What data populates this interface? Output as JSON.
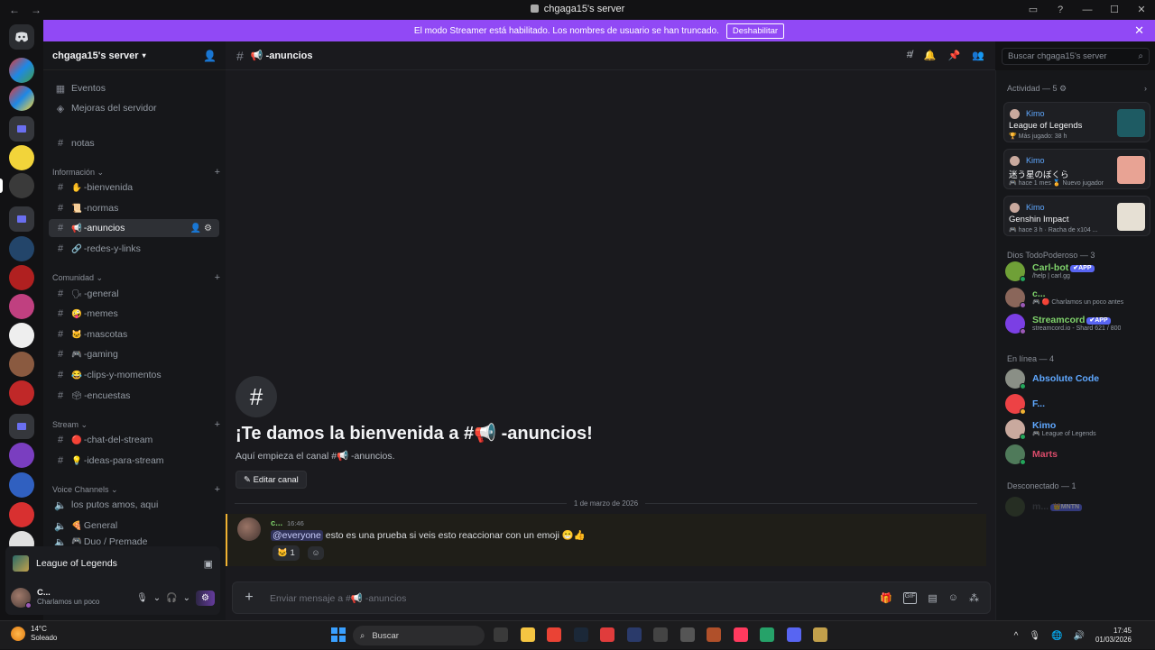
{
  "window": {
    "title": "chgaga15's server",
    "back": "←",
    "forward": "→",
    "controls": [
      "▭",
      "?",
      "—",
      "☐",
      "✕"
    ]
  },
  "banner": {
    "text": "El modo Streamer está habilitado. Los nombres de usuario se han truncado.",
    "button": "Deshabilitar",
    "close": "✕"
  },
  "server": {
    "name": "chgaga15's server",
    "caret": "▾",
    "invite_icon": "👤"
  },
  "sidebar": {
    "top_items": [
      {
        "icon": "▦",
        "label": "Eventos"
      },
      {
        "icon": "◈",
        "label": "Mejoras del servidor"
      }
    ],
    "standalone": {
      "label": "notas"
    },
    "categories": [
      {
        "name": "Información ⌄",
        "channels": [
          {
            "emoji": "✋",
            "label": "-bienvenida"
          },
          {
            "emoji": "📜",
            "label": "-normas"
          },
          {
            "emoji": "📢",
            "label": "-anuncios",
            "active": true
          },
          {
            "emoji": "🔗",
            "label": "-redes-y-links"
          }
        ]
      },
      {
        "name": "Comunidad ⌄",
        "channels": [
          {
            "emoji": "🗣",
            "label": "-general"
          },
          {
            "emoji": "🤪",
            "label": "-memes"
          },
          {
            "emoji": "🐱",
            "label": "-mascotas"
          },
          {
            "emoji": "🎮",
            "label": "-gaming"
          },
          {
            "emoji": "😂",
            "label": "-clips-y-momentos"
          },
          {
            "emoji": "🗳",
            "label": "-encuestas"
          }
        ]
      },
      {
        "name": "Stream ⌄",
        "channels": [
          {
            "emoji": "🔴",
            "label": "-chat-del-stream"
          },
          {
            "emoji": "💡",
            "label": "-ideas-para-stream"
          }
        ]
      },
      {
        "name": "Voice Channels ⌄",
        "channels": [
          {
            "emoji": "",
            "label": "los putos amos, aqui",
            "voice": true
          },
          {
            "emoji": "🍕",
            "label": "General",
            "voice": true
          },
          {
            "emoji": "🎮",
            "label": "Duo / Premade",
            "voice": true
          }
        ]
      }
    ],
    "active_actions": "👤⚙",
    "plus": "+"
  },
  "game_panel": {
    "title": "League of Legends",
    "button_icon": "▣"
  },
  "user_panel": {
    "name": "C...",
    "status": "Charlamos un poco",
    "mic": "🎙",
    "headset": "🎧",
    "caret": "⌄",
    "settings": "⚙"
  },
  "channel_header": {
    "hash": "#",
    "name": "📢 -anuncios",
    "icons": [
      "#̸",
      "🔔",
      "📌",
      "👥"
    ]
  },
  "search": {
    "placeholder": "Buscar chgaga15's server",
    "icon": "⌕"
  },
  "welcome": {
    "hash": "#",
    "title": "¡Te damos la bienvenida a #📢 -anuncios!",
    "subtitle": "Aquí empieza el canal #📢 -anuncios.",
    "edit_button": "✎ Editar canal"
  },
  "date_divider": "1 de marzo de 2026",
  "message": {
    "author": "c...",
    "time": "16:46",
    "mention": "@everyone",
    "text": " esto es una prueba si veis esto reaccionar con un emoji 😁👍",
    "reaction": "🐱  1",
    "add_reaction": "☺"
  },
  "composer": {
    "plus": "+",
    "placeholder": "Enviar mensaje a #📢 -anuncios",
    "icons": [
      "🎁",
      "GIF",
      "▤",
      "☺",
      "⁂"
    ]
  },
  "members": {
    "activity_header": "Actividad — 5 ⚙",
    "activity_chevron": "›",
    "activity_cards": [
      {
        "user": "Kimo",
        "game": "League of Legends",
        "meta": "🏆 Más jugado: 38 h",
        "art": "#1e5b63"
      },
      {
        "user": "Kimo",
        "game": "迷う星のぼくら",
        "meta": "🎮 hace 1 mes  🏅 Nuevo jugador",
        "art": "#e8a394"
      },
      {
        "user": "Kimo",
        "game": "Genshin Impact",
        "meta": "🎮 hace 3 h  · Racha de x104 ...",
        "art": "#e6e0d4"
      }
    ],
    "groups": [
      {
        "header": "Dios TodoPoderoso — 3",
        "members": [
          {
            "name": "Carl-bot",
            "badge": "✔APP",
            "sub": "/help | carl.gg",
            "color": "#7fd36b",
            "av": "#6fa037",
            "dot": "#23a55a"
          },
          {
            "name": "c...",
            "badge": "",
            "sub": "🎮 🔴 Charlamos un poco antes",
            "color": "#7fd36b",
            "av": "#8a665a",
            "dot": "#9b59b6"
          },
          {
            "name": "Streamcord",
            "badge": "✔APP",
            "sub": "streamcord.io - Shard 621 / 800",
            "color": "#7fd36b",
            "av": "#7b3fe4",
            "dot": "#9b59b6"
          }
        ]
      },
      {
        "header": "En línea — 4",
        "members": [
          {
            "name": "Absolute Code",
            "badge": "",
            "sub": "",
            "color": "#5fa8ff",
            "av": "#8a8f86",
            "dot": "#23a55a"
          },
          {
            "name": "F...",
            "badge": "",
            "sub": "",
            "color": "#5fa8ff",
            "av": "#ed4245",
            "dot": "#f0b232"
          },
          {
            "name": "Kimo",
            "badge": "",
            "sub": "🎮 League of Legends",
            "color": "#5fa8ff",
            "av": "#c9a99e",
            "dot": "#23a55a"
          },
          {
            "name": "Marts",
            "badge": "",
            "sub": "",
            "color": "#d94b6a",
            "av": "#4f7a5a",
            "dot": "#23a55a"
          }
        ]
      },
      {
        "header": "Desconectado — 1",
        "members": [
          {
            "name": "m...",
            "badge": "👑MNTN",
            "sub": "",
            "color": "#4a4d55",
            "av": "#3a4a30",
            "dot": ""
          }
        ]
      }
    ]
  },
  "taskbar": {
    "temp": "14°C",
    "weather": "Soleado",
    "search": "Buscar",
    "search_icon": "⌕",
    "apps": [
      "#3a3a3a",
      "#f5c542",
      "#ea4335",
      "#1b2838",
      "#e03c3c",
      "#2a3a6a",
      "#444444",
      "#555555",
      "#b0502a",
      "#ff3a5e",
      "#26a269",
      "#5865f2",
      "#c2a04b"
    ],
    "tray": [
      "^",
      "🎙",
      "🌐",
      "🔊"
    ],
    "time": "17:45",
    "date": "01/03/2026"
  }
}
